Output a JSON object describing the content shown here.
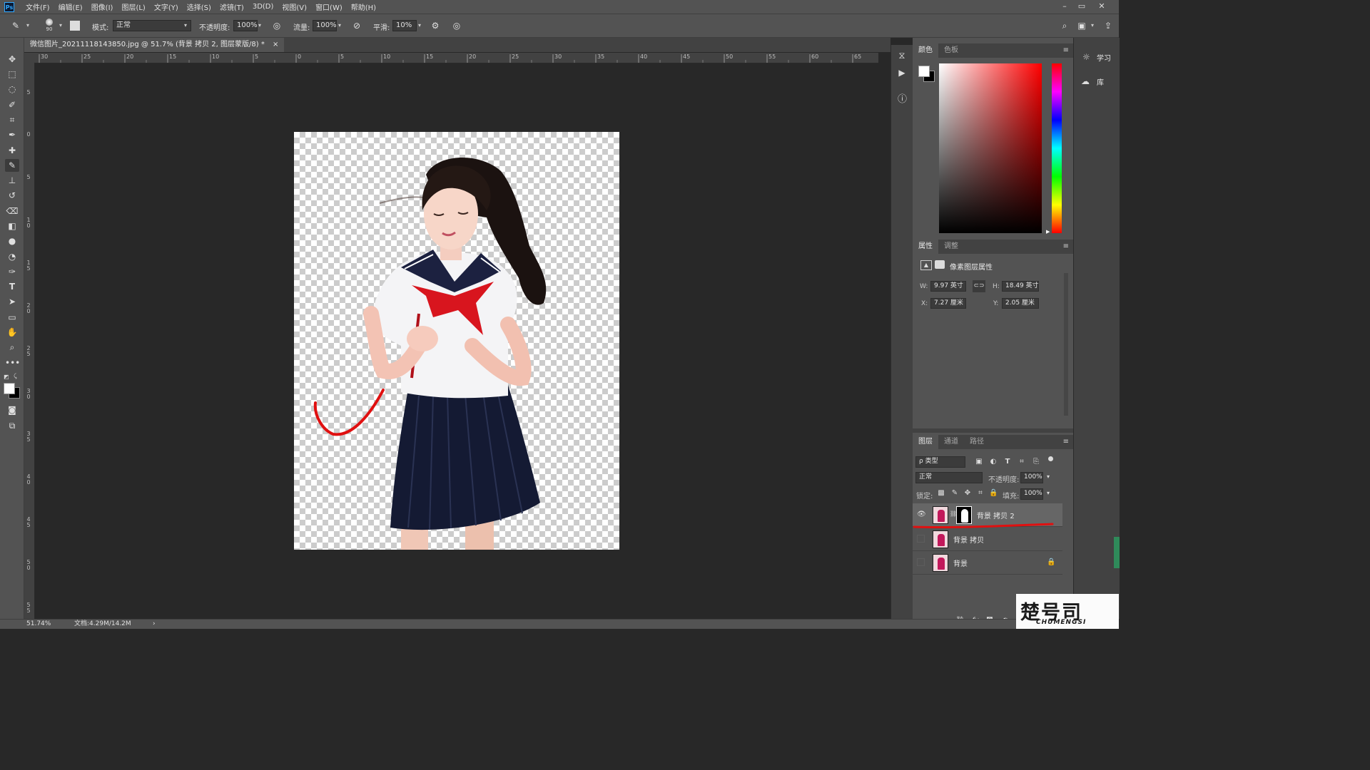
{
  "menubar": {
    "logo": "Ps",
    "items": [
      "文件(F)",
      "编辑(E)",
      "图像(I)",
      "图层(L)",
      "文字(Y)",
      "选择(S)",
      "滤镜(T)",
      "3D(D)",
      "视图(V)",
      "窗口(W)",
      "帮助(H)"
    ]
  },
  "options": {
    "brush_size": "90",
    "mode_label": "模式:",
    "mode_value": "正常",
    "opacity_label": "不透明度:",
    "opacity_value": "100%",
    "flow_label": "流量:",
    "flow_value": "100%",
    "smooth_label": "平滑:",
    "smooth_value": "10%"
  },
  "document": {
    "tab_title": "微信图片_20211118143850.jpg @ 51.7% (背景 拷贝 2, 图层蒙版/8) *",
    "close_glyph": "×"
  },
  "ruler_top": [
    "30",
    "25",
    "20",
    "15",
    "10",
    "5",
    "0",
    "5",
    "10",
    "15",
    "20",
    "25",
    "30",
    "35",
    "40",
    "45",
    "50",
    "55",
    "60",
    "65"
  ],
  "ruler_left": [
    "5",
    "0",
    "5",
    "1\n0",
    "1\n5",
    "2\n0",
    "2\n5",
    "3\n0",
    "3\n5",
    "4\n0",
    "4\n5",
    "5\n0",
    "5\n5"
  ],
  "status": {
    "zoom": "51.74%",
    "doc": "文档:4.29M/14.2M",
    "arrow": "›"
  },
  "color_panel": {
    "tabs": [
      "颜色",
      "色板"
    ],
    "hue_colors": [
      "#ff0000",
      "#ff00ff",
      "#0000ff",
      "#00ffff",
      "#00ff00",
      "#ffff00",
      "#ff0000"
    ],
    "base_hue": "#ff0000"
  },
  "properties_panel": {
    "tabs": [
      "属性",
      "调整"
    ],
    "subtitle": "像素图层属性",
    "w_label": "W:",
    "w_value": "9.97 英寸",
    "h_label": "H:",
    "h_value": "18.49 英寸",
    "x_label": "X:",
    "x_value": "7.27 厘米",
    "y_label": "Y:",
    "y_value": "2.05 厘米"
  },
  "layers_panel": {
    "tabs": [
      "图层",
      "通道",
      "路径"
    ],
    "filter_label": "ρ 类型",
    "blend_mode": "正常",
    "opacity_label": "不透明度:",
    "opacity_value": "100%",
    "lock_label": "锁定:",
    "fill_label": "填充:",
    "fill_value": "100%",
    "layers": [
      {
        "name": "背景 拷贝 2",
        "visible": true,
        "selected": true
      },
      {
        "name": "背景 拷贝",
        "visible": false,
        "selected": false
      },
      {
        "name": "背景",
        "visible": false,
        "selected": false,
        "locked": true
      }
    ]
  },
  "right_strip": {
    "learn": "学习",
    "library": "库"
  },
  "watermark": {
    "title": "楚号司",
    "subtitle": "CHUMENGSI"
  },
  "colors": {
    "ui_dark": "#282828",
    "ui_panel": "#535353",
    "accent_red": "#e01010"
  }
}
